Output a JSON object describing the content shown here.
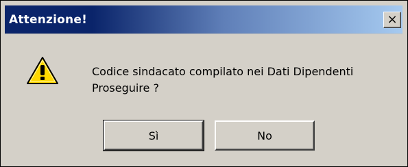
{
  "dialog": {
    "title": "Attenzione!",
    "close_glyph": "×",
    "icon": "warning-icon",
    "message_line1": "Codice sindacato compilato nei Dati Dipendenti",
    "message_line2": "Proseguire ?",
    "buttons": {
      "yes_label": "Sì",
      "no_label": "No"
    }
  },
  "colors": {
    "titlebar_start": "#0a246a",
    "titlebar_end": "#a6caf0",
    "dialog_bg": "#d4d0c8",
    "warning_fill": "#ffd800"
  }
}
